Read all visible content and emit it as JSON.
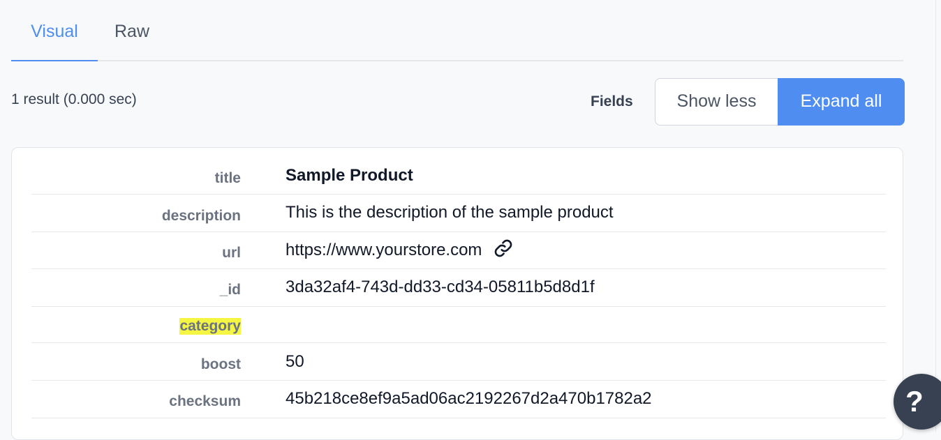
{
  "tabs": {
    "visual": "Visual",
    "raw": "Raw"
  },
  "results": {
    "summary": "1 result (0.000 sec)"
  },
  "fields": {
    "label": "Fields",
    "show_less": "Show less",
    "expand_all": "Expand all"
  },
  "record": {
    "title": {
      "key": "title",
      "value": "Sample Product"
    },
    "description": {
      "key": "description",
      "value": "This is the description of the sample product"
    },
    "url": {
      "key": "url",
      "value": "https://www.yourstore.com"
    },
    "id": {
      "key": "_id",
      "value": "3da32af4-743d-dd33-cd34-05811b5d8d1f"
    },
    "category": {
      "key": "category",
      "value": ""
    },
    "boost": {
      "key": "boost",
      "value": "50"
    },
    "checksum": {
      "key": "checksum",
      "value": "45b218ce8ef9a5ad06ac2192267d2a470b1782a2"
    }
  },
  "icons": {
    "url_link": "link-icon",
    "help": "question-icon"
  },
  "help": {
    "label": "?"
  },
  "colors": {
    "accent": "#4f8ef0",
    "highlight": "#f5f543",
    "help_bg": "#374151"
  }
}
